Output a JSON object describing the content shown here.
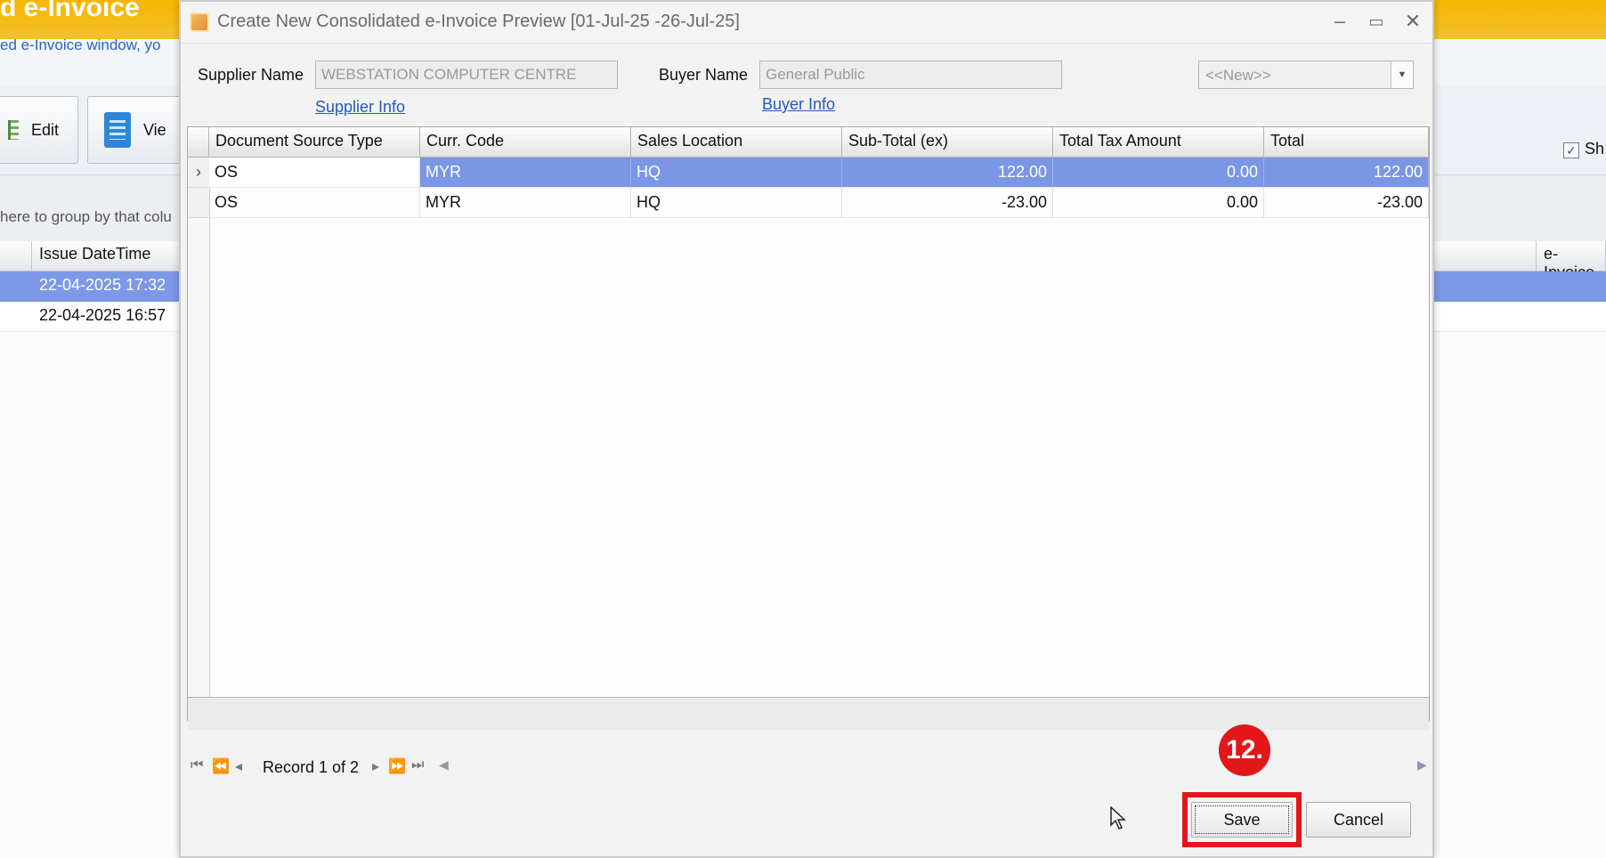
{
  "background": {
    "title": "d e-Invoice",
    "subtitle_link": "ed e-Invoice window, yo",
    "toolbar": {
      "edit_label": "Edit",
      "view_label": "Vie"
    },
    "group_hint": "here to group by that colu",
    "columns": {
      "issue_datetime": "Issue DateTime",
      "einvoice": "e-Invoice"
    },
    "rows": [
      {
        "issue_datetime": "22-04-2025 17:32",
        "selected": true
      },
      {
        "issue_datetime": "22-04-2025 16:57",
        "selected": false
      }
    ],
    "checkbox": {
      "label": "Sh",
      "checked": true
    }
  },
  "dialog": {
    "title": "Create New Consolidated e-Invoice Preview [01-Jul-25 -26-Jul-25]",
    "window_controls": {
      "minimize": "–",
      "maximize": "▭",
      "close": "✕"
    },
    "supplier": {
      "label": "Supplier Name",
      "value": "WEBSTATION COMPUTER CENTRE",
      "info_link": "Supplier Info"
    },
    "buyer": {
      "label": "Buyer Name",
      "value": "General Public",
      "info_link": "Buyer Info"
    },
    "buyer_select": {
      "value": "<<New>>"
    },
    "grid": {
      "columns": [
        "Document Source Type",
        "Curr. Code",
        "Sales Location",
        "Sub-Total (ex)",
        "Total Tax Amount",
        "Total"
      ],
      "rows": [
        {
          "source_type": "OS",
          "curr_code": "MYR",
          "sales_location": "HQ",
          "sub_total": "122.00",
          "tax": "0.00",
          "total": "122.00",
          "selected": true
        },
        {
          "source_type": "OS",
          "curr_code": "MYR",
          "sales_location": "HQ",
          "sub_total": "-23.00",
          "tax": "0.00",
          "total": "-23.00",
          "selected": false
        }
      ]
    },
    "navigator": {
      "record_text": "Record 1 of 2"
    },
    "buttons": {
      "save": "Save",
      "cancel": "Cancel"
    }
  },
  "annotation": {
    "step_label": "12.",
    "color": "#e3161a"
  },
  "colors": {
    "selection": "#7b96e5",
    "header_accent": "#f7b500",
    "link": "#2457c5"
  }
}
